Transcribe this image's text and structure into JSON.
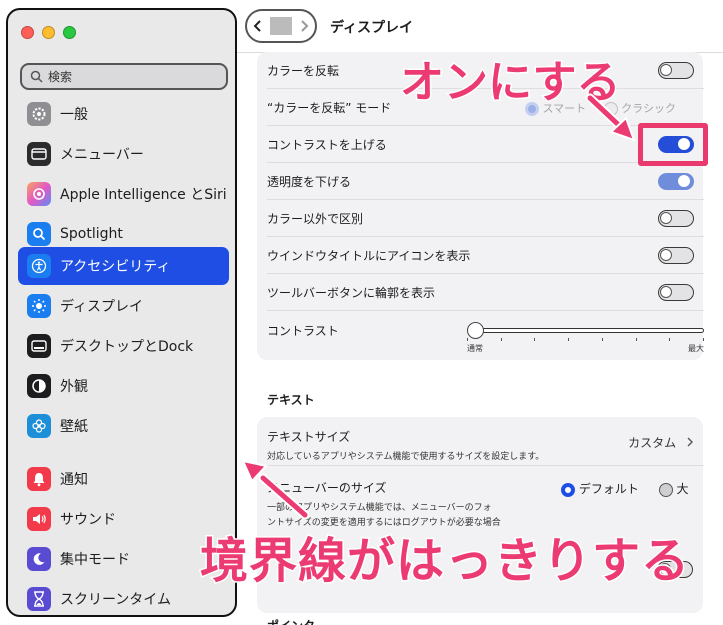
{
  "sidebar": {
    "search_placeholder": "検索",
    "items": [
      {
        "label": "一般",
        "icon": "gear-icon",
        "color": "#8e8e93"
      },
      {
        "label": "メニューバー",
        "icon": "menubar-icon",
        "color": "#1d1d1f"
      },
      {
        "label": "Apple Intelligence とSiri",
        "icon": "apple-intelligence-icon",
        "color": "#c86dd7"
      },
      {
        "label": "Spotlight",
        "icon": "spotlight-icon",
        "color": "#1a7df0"
      },
      {
        "label": "アクセシビリティ",
        "icon": "accessibility-icon",
        "color": "#1a7df0"
      },
      {
        "label": "ディスプレイ",
        "icon": "display-icon",
        "color": "#1a7df0"
      },
      {
        "label": "デスクトップとDock",
        "icon": "dock-icon",
        "color": "#1d1d1f"
      },
      {
        "label": "外観",
        "icon": "appearance-icon",
        "color": "#1d1d1f"
      },
      {
        "label": "壁紙",
        "icon": "wallpaper-icon",
        "color": "#1d8fd8"
      },
      {
        "label": "通知",
        "icon": "notification-icon",
        "color": "#f23a4b"
      },
      {
        "label": "サウンド",
        "icon": "sound-icon",
        "color": "#f23a4b"
      },
      {
        "label": "集中モード",
        "icon": "focus-icon",
        "color": "#5a4bd3"
      },
      {
        "label": "スクリーンタイム",
        "icon": "screen-time-icon",
        "color": "#5a4bd3"
      }
    ]
  },
  "header": {
    "title": "ディスプレイ"
  },
  "display_settings": {
    "rows": [
      {
        "label": "カラーを反転",
        "state": "off"
      },
      {
        "label": "“カラーを反転” モード",
        "options": [
          "スマート",
          "クラシック"
        ],
        "selected": "スマート"
      },
      {
        "label": "コントラストを上げる",
        "state": "on"
      },
      {
        "label": "透明度を下げる",
        "state": "on"
      },
      {
        "label": "カラー以外で区別",
        "state": "off"
      },
      {
        "label": "ウインドウタイトルにアイコンを表示",
        "state": "off"
      },
      {
        "label": "ツールバーボタンに輪郭を表示",
        "state": "off"
      }
    ],
    "contrast": {
      "label": "コントラスト",
      "min_label": "通常",
      "max_label": "最大",
      "value": 0
    }
  },
  "text_section": {
    "title": "テキスト",
    "text_size": {
      "label": "テキストサイズ",
      "description": "対応しているアプリやシステム機能で使用するサイズを設定します。",
      "value": "カスタム"
    },
    "menubar_size": {
      "label": "メニューバーのサイズ",
      "description_1": "一部のアプリやシステム機能では、メニューバーのフォ",
      "description_2": "ントサイズの変更を適用するにはログアウトが必要な場合",
      "options": [
        "デフォルト",
        "大"
      ],
      "selected": "デフォルト"
    }
  },
  "pointer_section": {
    "title": "ポインタ"
  },
  "annotations": {
    "toggle_callout": "オンにする",
    "border_callout": "境界線がはっきりする",
    "accent_color": "#ec3a72"
  }
}
